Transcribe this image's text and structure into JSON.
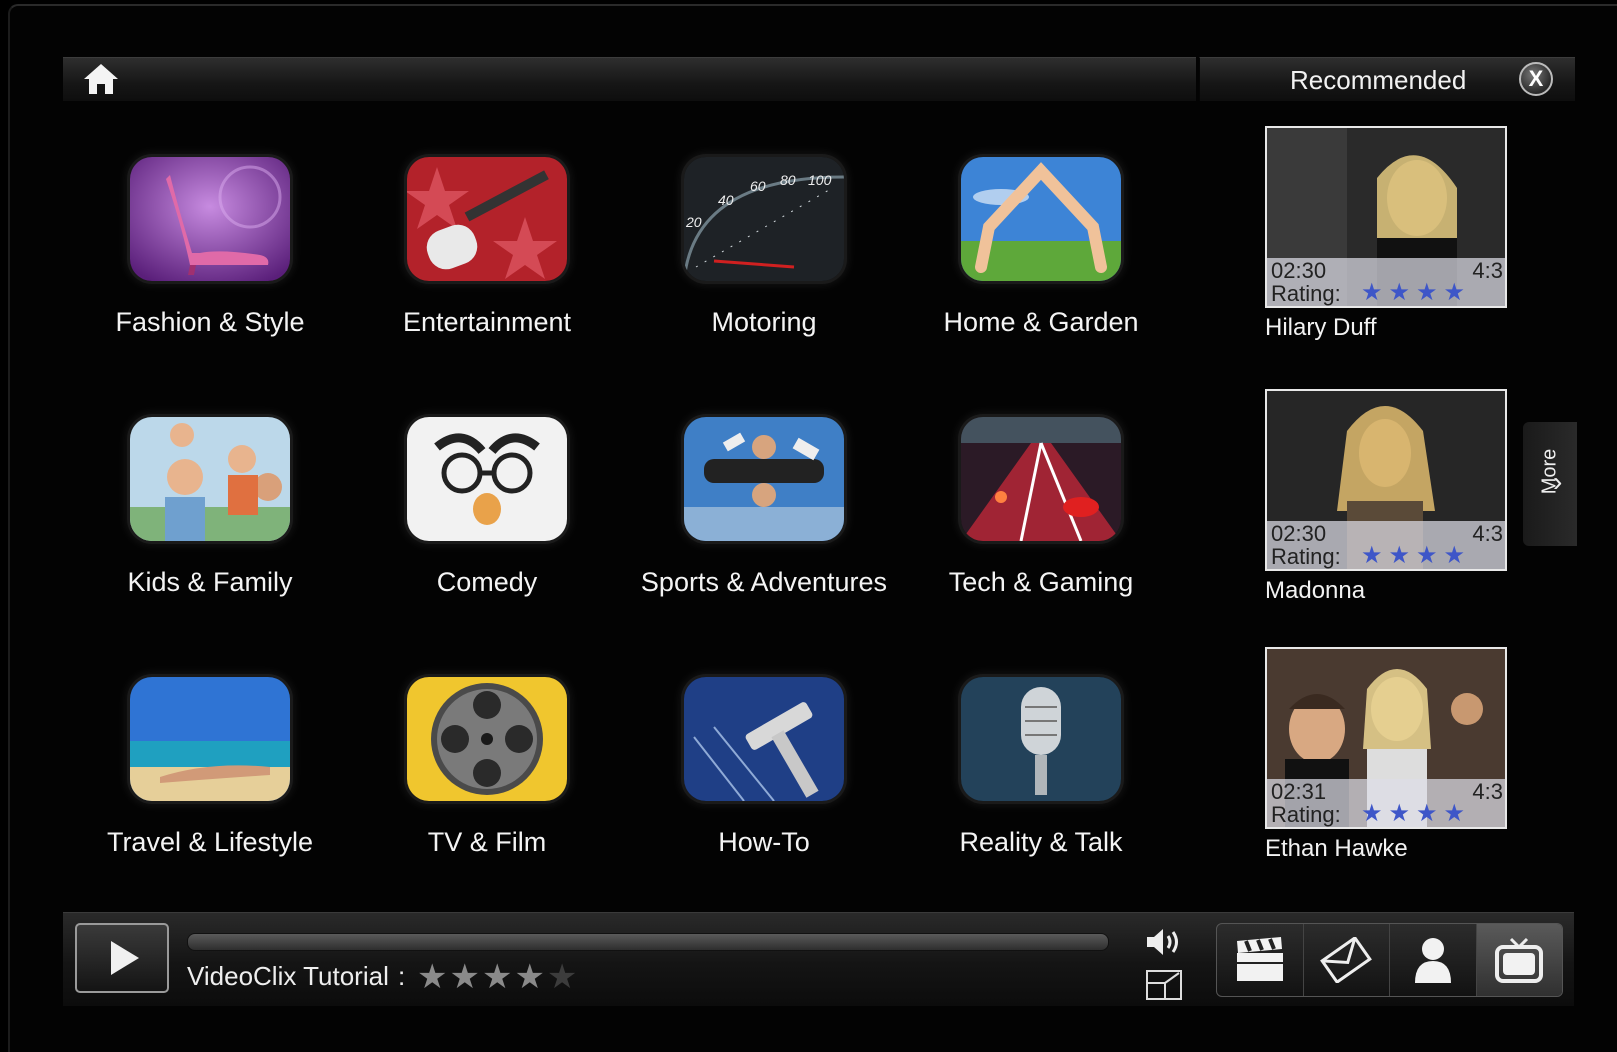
{
  "header": {
    "home_icon": "home-icon"
  },
  "recommended": {
    "title": "Recommended",
    "close_label": "X",
    "more_label": "More",
    "items": [
      {
        "name": "Hilary Duff",
        "duration": "02:30",
        "ratio": "4:3",
        "rating_label": "Rating:",
        "stars": "★★★★"
      },
      {
        "name": "Madonna",
        "duration": "02:30",
        "ratio": "4:3",
        "rating_label": "Rating:",
        "stars": "★★★★"
      },
      {
        "name": "Ethan Hawke",
        "duration": "02:31",
        "ratio": "4:3",
        "rating_label": "Rating:",
        "stars": "★★★★"
      }
    ]
  },
  "categories": [
    {
      "label": "Fashion & Style"
    },
    {
      "label": "Entertainment"
    },
    {
      "label": "Motoring"
    },
    {
      "label": "Home & Garden"
    },
    {
      "label": "Kids & Family"
    },
    {
      "label": "Comedy"
    },
    {
      "label": "Sports & Adventures"
    },
    {
      "label": "Tech & Gaming"
    },
    {
      "label": "Travel & Lifestyle"
    },
    {
      "label": "TV & Film"
    },
    {
      "label": "How-To"
    },
    {
      "label": "Reality & Talk"
    }
  ],
  "player": {
    "now_playing": "VideoClix Tutorial",
    "separator": ":",
    "rating_filled": "★★★★",
    "rating_empty": "★",
    "rating_value": 4,
    "rating_max": 5
  },
  "speedometer": {
    "numbers": [
      "20",
      "40",
      "60",
      "80",
      "100"
    ]
  },
  "toolbar": {
    "icons": [
      "clapperboard-icon",
      "envelope-icon",
      "user-icon",
      "tv-icon"
    ]
  }
}
